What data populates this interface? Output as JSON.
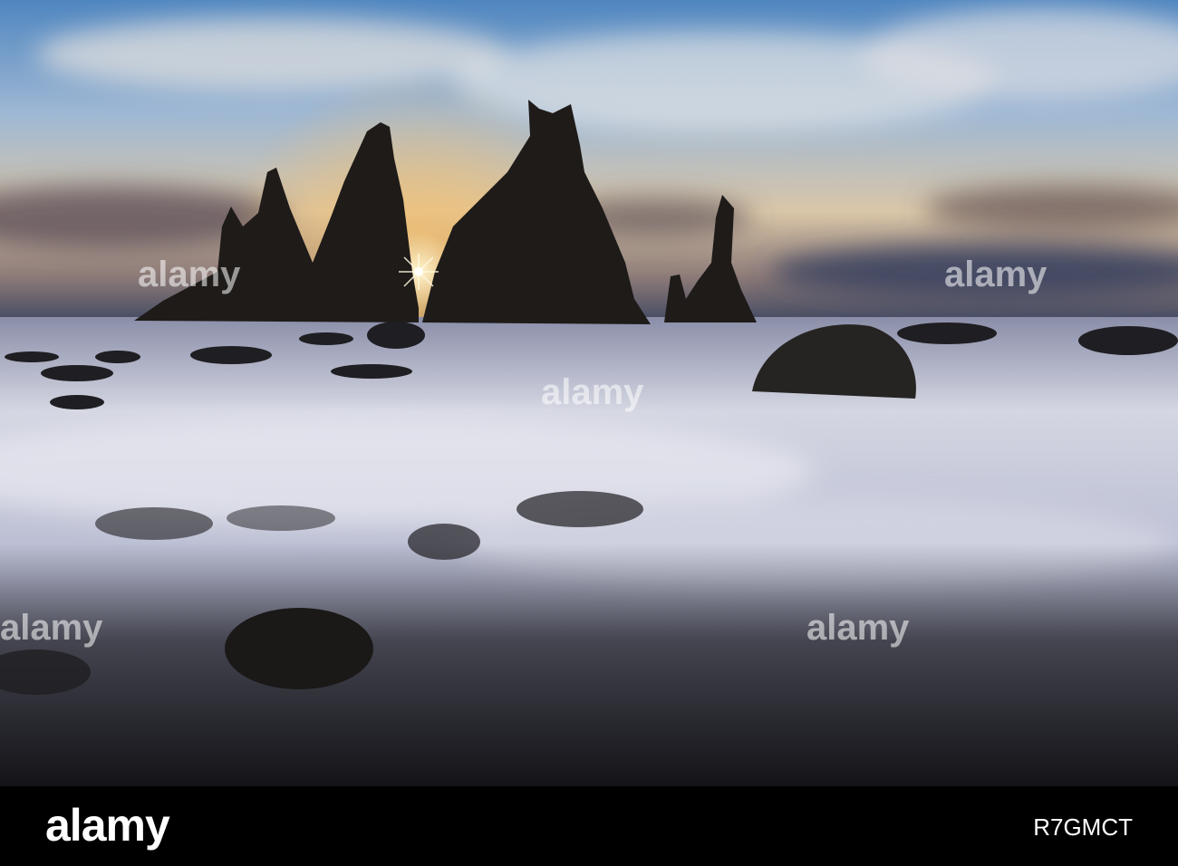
{
  "photo": {
    "subject": "Sea stacks at sunset",
    "colors": {
      "sky_top": "#3a78b8",
      "sky_mid": "#b8c8d8",
      "sunset": "#f0c070",
      "rock": "#1c1a18",
      "water": "#c8ccd8",
      "beach": "#2a2a30"
    }
  },
  "watermark": {
    "text": "alamy"
  },
  "footer": {
    "logo": "alamy",
    "image_id": "R7GMCT"
  }
}
